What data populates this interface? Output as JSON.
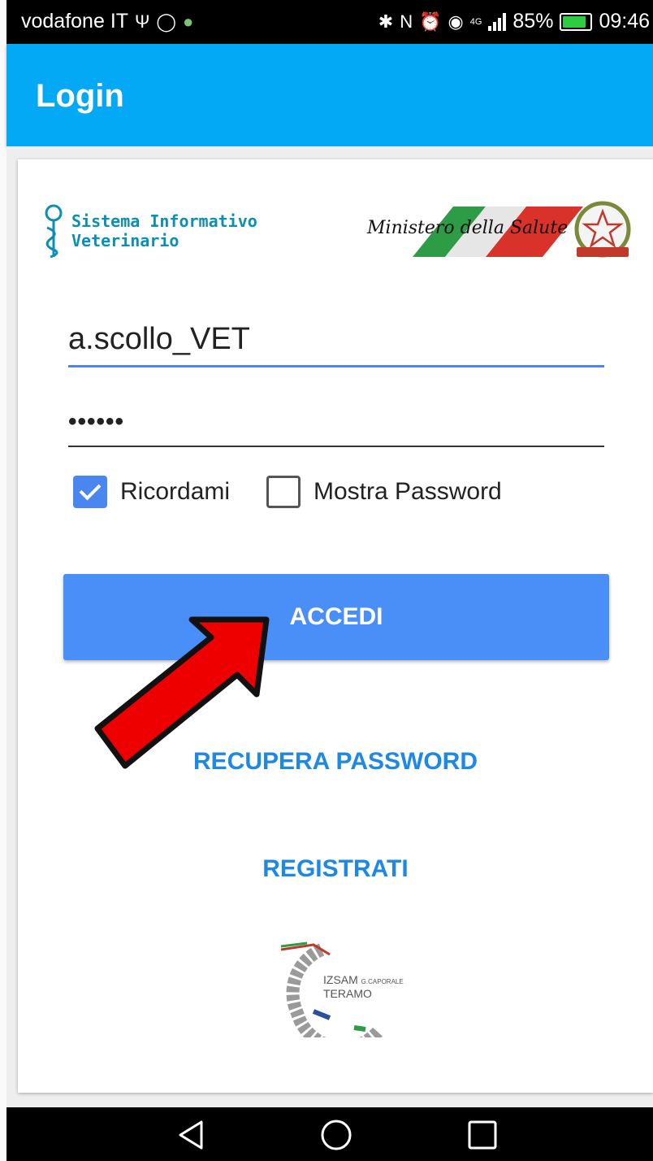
{
  "status_bar": {
    "carrier": "vodafone IT",
    "network": "4G",
    "battery": "85%",
    "battery_level": 0.85,
    "time": "09:46"
  },
  "app_bar": {
    "title": "Login"
  },
  "logos": {
    "siv_line1": "Sistema Informativo",
    "siv_line2": "Veterinario",
    "ministero": "Ministero della Salute",
    "izsam_name": "IZSAM",
    "izsam_sub": "G.CAPORALE",
    "izsam_city": "TERAMO"
  },
  "form": {
    "username": "a.scollo_VET",
    "password_masked": "••••••",
    "remember_label": "Ricordami",
    "remember_checked": true,
    "show_password_label": "Mostra Password",
    "show_password_checked": false
  },
  "buttons": {
    "login": "ACCEDI",
    "recover_password": "RECUPERA PASSWORD",
    "register": "REGISTRATI"
  },
  "colors": {
    "app_bar": "#03a9f4",
    "primary_button": "#4a8ff7",
    "link": "#1e88e5",
    "arrow": "#ee0000"
  }
}
